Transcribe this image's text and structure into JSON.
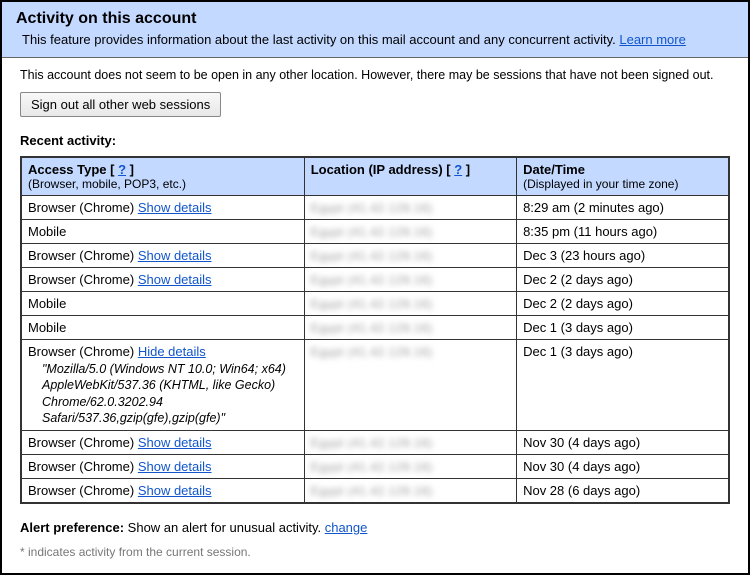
{
  "banner": {
    "title": "Activity on this account",
    "description": "This feature provides information about the last activity on this mail account and any concurrent activity.",
    "learn_more": "Learn more"
  },
  "status_text": "This account does not seem to be open in any other location. However, there may be sessions that have not been signed out.",
  "signout_button": "Sign out all other web sessions",
  "recent_heading": "Recent activity:",
  "table": {
    "headers": {
      "access_label": "Access Type",
      "access_sub": "(Browser, mobile, POP3, etc.)",
      "location_label": "Location (IP address)",
      "datetime_label": "Date/Time",
      "datetime_sub": "(Displayed in your time zone)",
      "help_q": "?"
    },
    "show_details": "Show details",
    "hide_details": "Hide details",
    "rows": [
      {
        "access": "Browser (Chrome)",
        "details_link": true,
        "expanded": false,
        "time": "8:29 am (2 minutes ago)"
      },
      {
        "access": "Mobile",
        "details_link": false,
        "expanded": false,
        "time": "8:35 pm (11 hours ago)"
      },
      {
        "access": "Browser (Chrome)",
        "details_link": true,
        "expanded": false,
        "time": "Dec 3 (23 hours ago)"
      },
      {
        "access": "Browser (Chrome)",
        "details_link": true,
        "expanded": false,
        "time": "Dec 2 (2 days ago)"
      },
      {
        "access": "Mobile",
        "details_link": false,
        "expanded": false,
        "time": "Dec 2 (2 days ago)"
      },
      {
        "access": "Mobile",
        "details_link": false,
        "expanded": false,
        "time": "Dec 1 (3 days ago)"
      },
      {
        "access": "Browser (Chrome)",
        "details_link": true,
        "expanded": true,
        "time": "Dec 1 (3 days ago)",
        "ua": "\"Mozilla/5.0 (Windows NT 10.0; Win64; x64) AppleWebKit/537.36 (KHTML, like Gecko) Chrome/62.0.3202.94 Safari/537.36,gzip(gfe),gzip(gfe)\""
      },
      {
        "access": "Browser (Chrome)",
        "details_link": true,
        "expanded": false,
        "time": "Nov 30 (4 days ago)"
      },
      {
        "access": "Browser (Chrome)",
        "details_link": true,
        "expanded": false,
        "time": "Nov 30 (4 days ago)"
      },
      {
        "access": "Browser (Chrome)",
        "details_link": true,
        "expanded": false,
        "time": "Nov 28 (6 days ago)"
      }
    ],
    "redacted_placeholder": "Egypt (41.42.129.16)"
  },
  "alert_pref": {
    "label": "Alert preference:",
    "text": "Show an alert for unusual activity.",
    "change": "change"
  },
  "footnote": "* indicates activity from the current session."
}
